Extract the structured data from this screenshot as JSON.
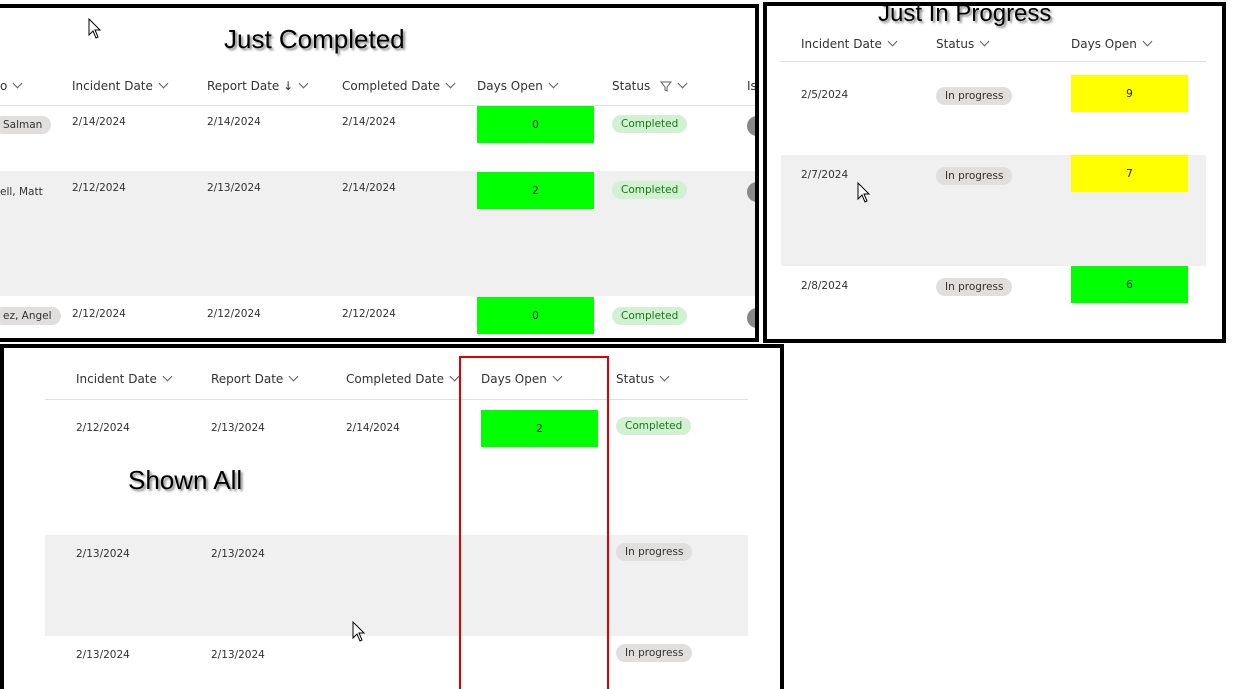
{
  "completed_panel": {
    "title": "Just Completed",
    "headers": {
      "partial_left": "o",
      "incident": "Incident Date",
      "report": "Report Date",
      "report_sort": "↓",
      "completed": "Completed Date",
      "days_open": "Days Open",
      "status": "Status",
      "partial_right": "Is"
    },
    "rows": [
      {
        "person": "Salman",
        "incident": "2/14/2024",
        "report": "2/14/2024",
        "completed": "2/14/2024",
        "days": "0",
        "days_color": "#00ff00",
        "status": "Completed"
      },
      {
        "person": "ell, Matt",
        "incident": "2/12/2024",
        "report": "2/13/2024",
        "completed": "2/14/2024",
        "days": "2",
        "days_color": "#00ff00",
        "status": "Completed"
      },
      {
        "person": "ez, Angel",
        "incident": "2/12/2024",
        "report": "2/12/2024",
        "completed": "2/12/2024",
        "days": "0",
        "days_color": "#00ff00",
        "status": "Completed"
      }
    ]
  },
  "progress_panel": {
    "title": "Just In Progress",
    "headers": {
      "incident": "Incident Date",
      "status": "Status",
      "days_open": "Days Open"
    },
    "rows": [
      {
        "incident": "2/5/2024",
        "status": "In progress",
        "days": "9",
        "days_color": "#ffff00"
      },
      {
        "incident": "2/7/2024",
        "status": "In progress",
        "days": "7",
        "days_color": "#ffff00"
      },
      {
        "incident": "2/8/2024",
        "status": "In progress",
        "days": "6",
        "days_color": "#00ff00"
      }
    ]
  },
  "all_panel": {
    "title": "Shown All",
    "headers": {
      "incident": "Incident Date",
      "report": "Report Date",
      "completed": "Completed Date",
      "days_open": "Days Open",
      "status": "Status"
    },
    "rows": [
      {
        "incident": "2/12/2024",
        "report": "2/13/2024",
        "completed": "2/14/2024",
        "days": "2",
        "days_color": "#00ff00",
        "status": "Completed"
      },
      {
        "incident": "2/13/2024",
        "report": "2/13/2024",
        "completed": "",
        "days": "",
        "status": "In progress"
      },
      {
        "incident": "2/13/2024",
        "report": "2/13/2024",
        "completed": "",
        "days": "",
        "status": "In progress"
      }
    ]
  },
  "colors": {
    "green": "#00ff00",
    "yellow": "#ffff00",
    "highlight": "#e00000"
  }
}
